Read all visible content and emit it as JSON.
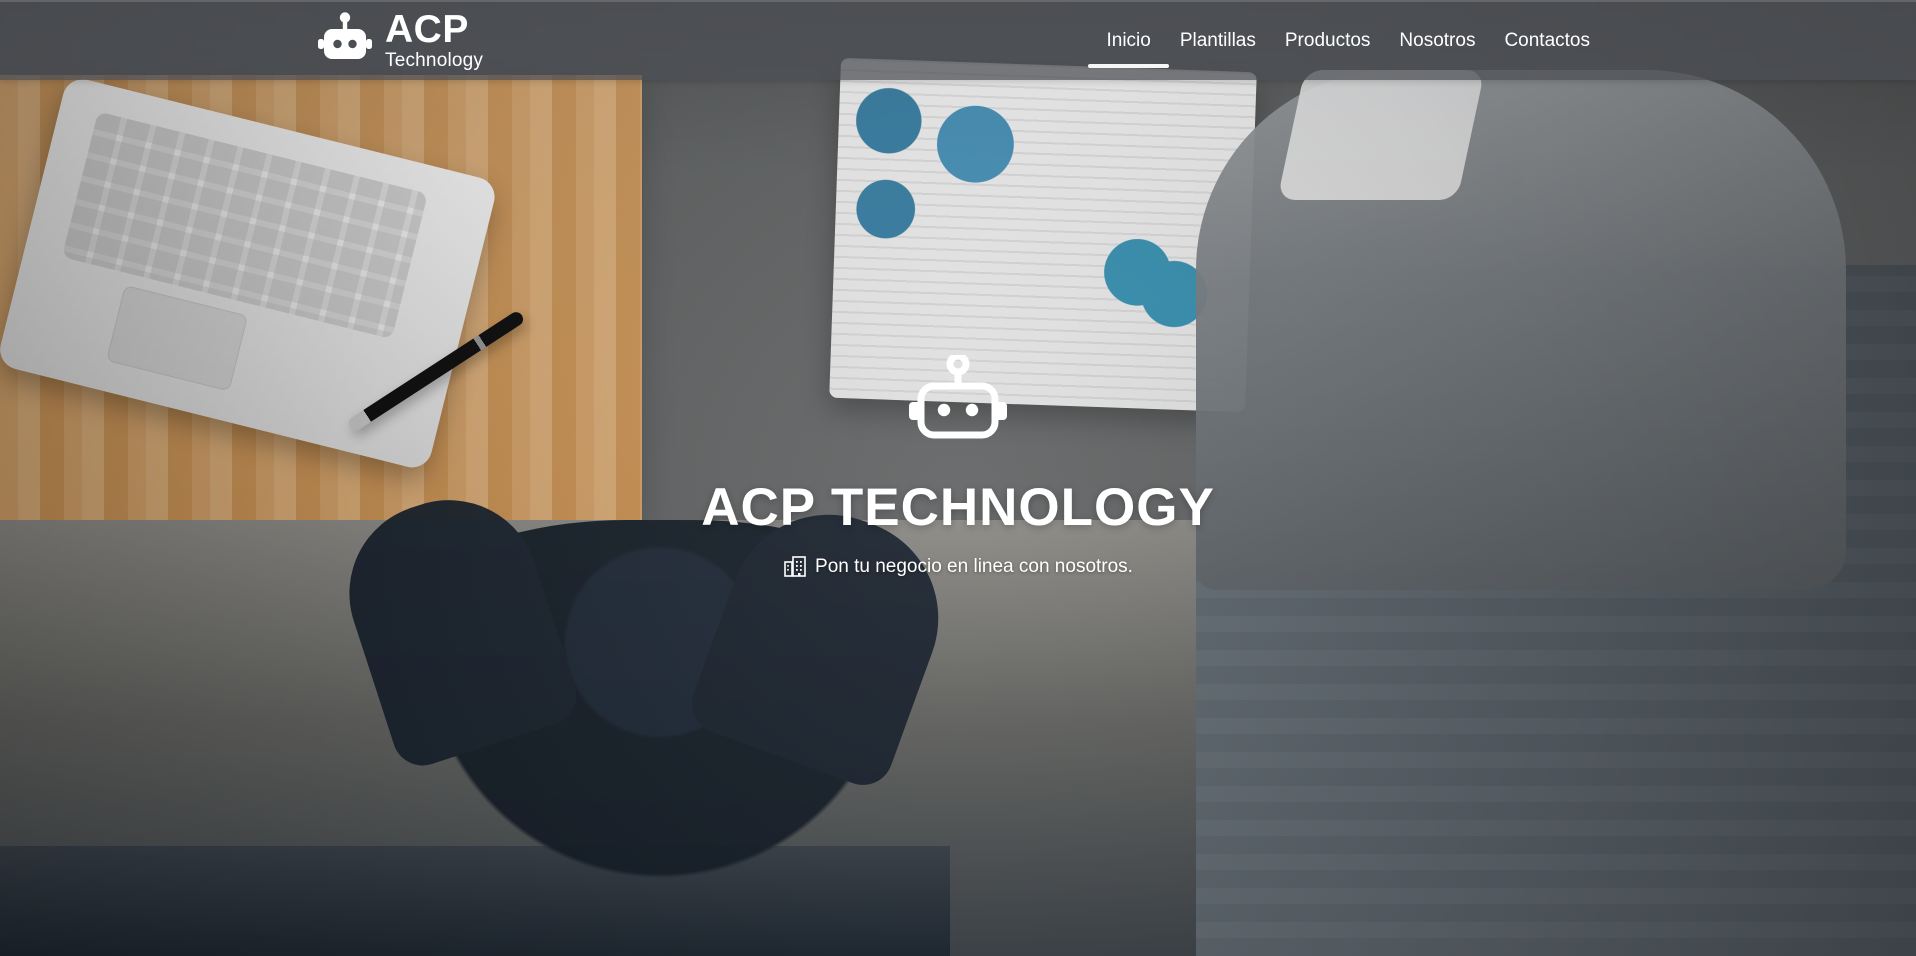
{
  "brand": {
    "title": "ACP",
    "subtitle": "Technology",
    "logo_icon": "robot-icon"
  },
  "nav": {
    "items": [
      {
        "label": "Inicio",
        "active": true
      },
      {
        "label": "Plantillas",
        "active": false
      },
      {
        "label": "Productos",
        "active": false
      },
      {
        "label": "Nosotros",
        "active": false
      },
      {
        "label": "Contactos",
        "active": false
      }
    ]
  },
  "hero": {
    "robot_icon": "robot-icon",
    "title": "ACP TECHNOLOGY",
    "tagline_icon": "building-icon",
    "tagline": "Pon tu negocio en linea con nosotros."
  },
  "colors": {
    "text": "#ffffff",
    "header_bg": "#4b4e53",
    "header_alpha": "0.72"
  }
}
